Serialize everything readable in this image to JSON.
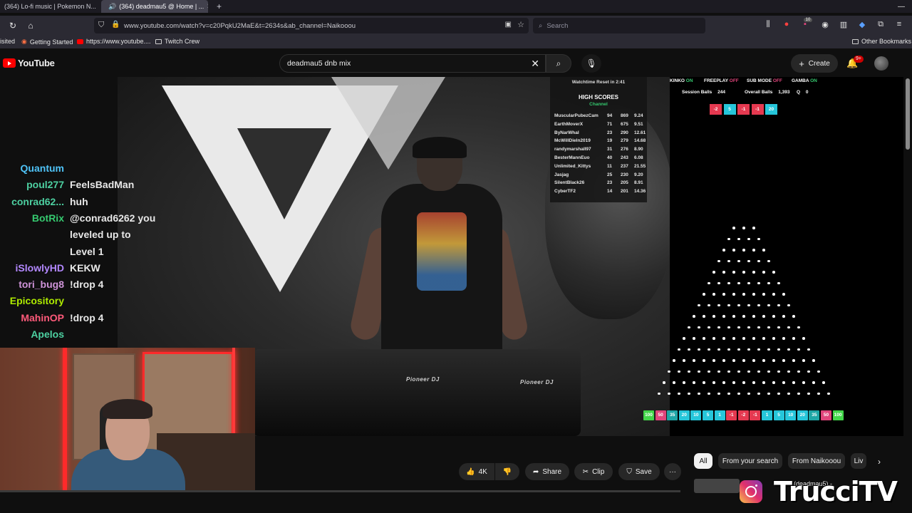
{
  "browser": {
    "tabs": [
      {
        "label": "(364) Lo-fi music | Pokemon N...",
        "active": false
      },
      {
        "label": "(364) deadmau5 @ Home | ...",
        "active": true
      }
    ],
    "new_tab": "+",
    "url": "www.youtube.com/watch?v=c20PqkU2MaE&t=2634s&ab_channel=Naikooou",
    "search_placeholder": "Search",
    "bookmarks": [
      "isited",
      "Getting Started",
      "https://www.youtube....",
      "Twitch Crew"
    ],
    "other_bookmarks": "Other Bookmarks",
    "badge_count": "10"
  },
  "youtube": {
    "logo": "YouTube",
    "search_value": "deadmau5 dnb mix",
    "create_label": "Create",
    "notif_badge": "9+",
    "actions": {
      "likes": "4K",
      "share": "Share",
      "clip": "Clip",
      "save": "Save",
      "more": "···"
    },
    "chips": [
      "All",
      "From your search",
      "From Naikooou",
      "Liv"
    ],
    "rec_title": "ttpilot (deadmau5) -"
  },
  "overlay": {
    "watchtime": "Watchtime Reset in 2:41",
    "high_scores_title": "HIGH SCORES",
    "high_scores_sub": "Channel",
    "scores": [
      {
        "name": "MuscularPubezCam",
        "a": "94",
        "b": "869",
        "c": "9.24"
      },
      {
        "name": "EarthMoverX",
        "a": "71",
        "b": "675",
        "c": "9.51"
      },
      {
        "name": "ByNarWhal",
        "a": "23",
        "b": "290",
        "c": "12.61"
      },
      {
        "name": "McWillDieIn2019",
        "a": "19",
        "b": "279",
        "c": "14.68"
      },
      {
        "name": "randymarshall97",
        "a": "31",
        "b": "276",
        "c": "8.90"
      },
      {
        "name": "BesterMannEuo",
        "a": "40",
        "b": "243",
        "c": "6.08"
      },
      {
        "name": "Unlimited_Kittys",
        "a": "11",
        "b": "237",
        "c": "21.55"
      },
      {
        "name": "Jasjag",
        "a": "25",
        "b": "230",
        "c": "9.20"
      },
      {
        "name": "SilentBlack26",
        "a": "23",
        "b": "205",
        "c": "8.91"
      },
      {
        "name": "CyberTF2",
        "a": "14",
        "b": "201",
        "c": "14.36"
      }
    ],
    "plinko": {
      "status": [
        {
          "label": "KINKO",
          "state": "ON"
        },
        {
          "label": "FREEPLAY",
          "state": "OFF"
        },
        {
          "label": "SUB MODE",
          "state": "OFF"
        },
        {
          "label": "GAMBA",
          "state": "ON"
        }
      ],
      "session_balls_label": "Session Balls",
      "session_balls": "244",
      "overall_balls_label": "Overall Balls",
      "overall_balls": "1,393",
      "q_label": "Q",
      "q_value": "0",
      "chips": [
        "-2",
        "5",
        "-1",
        "-1",
        "20"
      ],
      "buckets": [
        "100",
        "50",
        "35",
        "20",
        "10",
        "5",
        "1",
        "-1",
        "-2",
        "-1",
        "1",
        "5",
        "10",
        "20",
        "35",
        "50",
        "100"
      ]
    },
    "mixer_brand": "Pioneer DJ"
  },
  "chat": [
    {
      "name": "Quantum",
      "msg": "",
      "color": "#4fc3f7"
    },
    {
      "name": "poul277",
      "msg": "FeelsBadMan",
      "color": "#4dd0a1"
    },
    {
      "name": "conrad62...",
      "msg": "huh",
      "color": "#4dd0a1"
    },
    {
      "name": "BotRix",
      "msg": "@conrad6262 you",
      "color": "#35c96f"
    },
    {
      "name": "",
      "msg": "leveled up to",
      "color": "#35c96f"
    },
    {
      "name": "",
      "msg": "Level 1",
      "color": "#35c96f"
    },
    {
      "name": "iSlowlyHD",
      "msg": "KEKW",
      "color": "#b388ff"
    },
    {
      "name": "tori_bug8",
      "msg": "!drop 4",
      "color": "#ce93d8"
    },
    {
      "name": "Epicository",
      "msg": "",
      "color": "#aeea00"
    },
    {
      "name": "MahinOP",
      "msg": "!drop 4",
      "color": "#ff5a7a"
    },
    {
      "name": "Apelos",
      "msg": "",
      "color": "#4dd0a1"
    }
  ],
  "brand_watermark": "TrucciTV",
  "colors": {
    "yt_red": "#ff0000",
    "plinko_green": "#35c96f",
    "plinko_pink": "#e0457b",
    "plinko_cyan": "#26c6da",
    "plinko_red": "#e53950"
  }
}
